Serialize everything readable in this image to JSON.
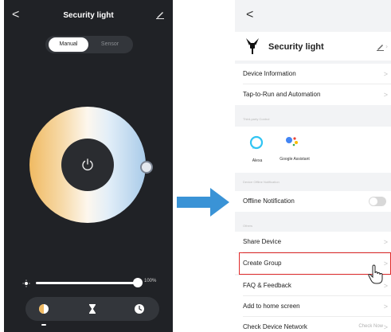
{
  "left_screen": {
    "back_glyph": "<",
    "title": "Security light",
    "modes": [
      "Manual",
      "Sensor"
    ],
    "brightness_percent": "100%",
    "brightness_value": 100,
    "icons": {
      "edit": "pencil-icon",
      "power": "power-icon",
      "brightness": "sun-icon",
      "color": "color-circle-icon",
      "timer": "hourglass-icon",
      "schedule": "clock-icon"
    }
  },
  "right_screen": {
    "back_glyph": "<",
    "device_name": "Security light",
    "chevron_glyph": ">",
    "rows": {
      "device_info": "Device Information",
      "tap_to_run": "Tap-to-Run and Automation",
      "offline_notification": "Offline Notification",
      "share_device": "Share Device",
      "create_group": "Create Group",
      "faq": "FAQ & Feedback",
      "add_home": "Add to home screen",
      "check_network": "Check Device Network"
    },
    "sections": {
      "third_party": "Third-party Control",
      "offline": "Device Offline Notification",
      "others": "Others"
    },
    "third_party_services": [
      "Alexa",
      "Google Assistant"
    ],
    "check_now": "Check Now",
    "offline_toggle_on": false
  },
  "colors": {
    "dark_bg": "#202226",
    "arrow": "#3a93d6",
    "highlight": "#e02a2a"
  }
}
